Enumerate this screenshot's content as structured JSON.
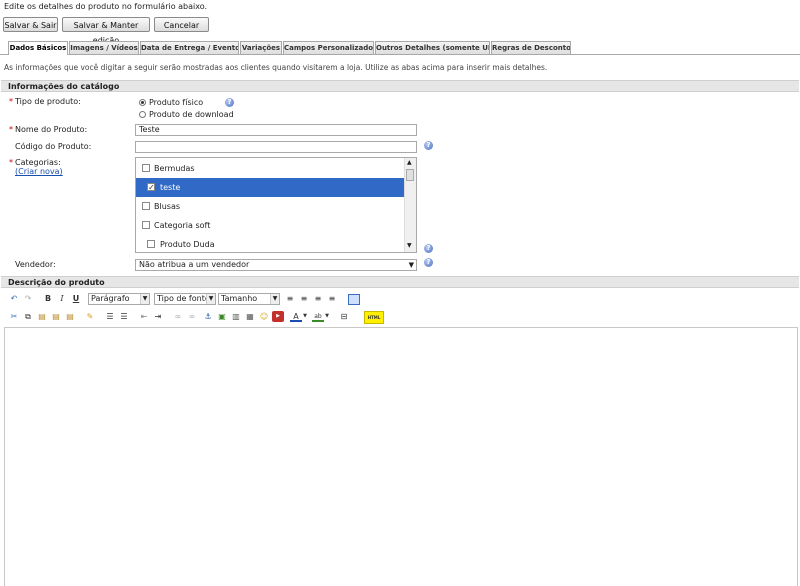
{
  "intro": "Edite os detalhes do produto no formulário abaixo.",
  "buttons": {
    "save_exit": "Salvar & Sair",
    "save_keep": "Salvar & Manter edição",
    "cancel": "Cancelar"
  },
  "tabs": [
    {
      "label": "Dados Básicos"
    },
    {
      "label": "Imagens / Vídeos"
    },
    {
      "label": "Data de Entrega / Evento"
    },
    {
      "label": "Variações"
    },
    {
      "label": "Campos Personalizados"
    },
    {
      "label": "Outros Detalhes (somente UI)"
    },
    {
      "label": "Regras de Desconto"
    }
  ],
  "info_text": "As informações que você digitar a seguir serão mostradas aos clientes quando visitarem a loja. Utilize as abas acima para inserir mais detalhes.",
  "catalog": {
    "title": "Informações do catálogo",
    "product_type_label": "Tipo de produto:",
    "type_physical": "Produto físico",
    "type_download": "Produto de download",
    "name_label": "Nome do Produto:",
    "name_value": "Teste",
    "code_label": "Código do Produto:",
    "code_value": "",
    "categories_label": "Categorias:",
    "create_new": "(Criar nova)",
    "categories": [
      {
        "label": "Bermudas",
        "checked": false
      },
      {
        "label": "teste",
        "checked": true
      },
      {
        "label": "Blusas",
        "checked": false
      },
      {
        "label": "Categoria soft",
        "checked": false
      },
      {
        "label": "Produto Duda",
        "checked": false
      }
    ],
    "vendor_label": "Vendedor:",
    "vendor_value": "Não atribua a um vendedor",
    "required_mark": "*"
  },
  "description": {
    "title": "Descrição do produto",
    "format_select": "Parágrafo",
    "font_select": "Tipo de fonte",
    "size_select": "Tamanho",
    "html_label": "HTML"
  },
  "colors": {
    "selection": "#3169c6",
    "required": "#cc0000",
    "link": "#1a4fb0"
  }
}
